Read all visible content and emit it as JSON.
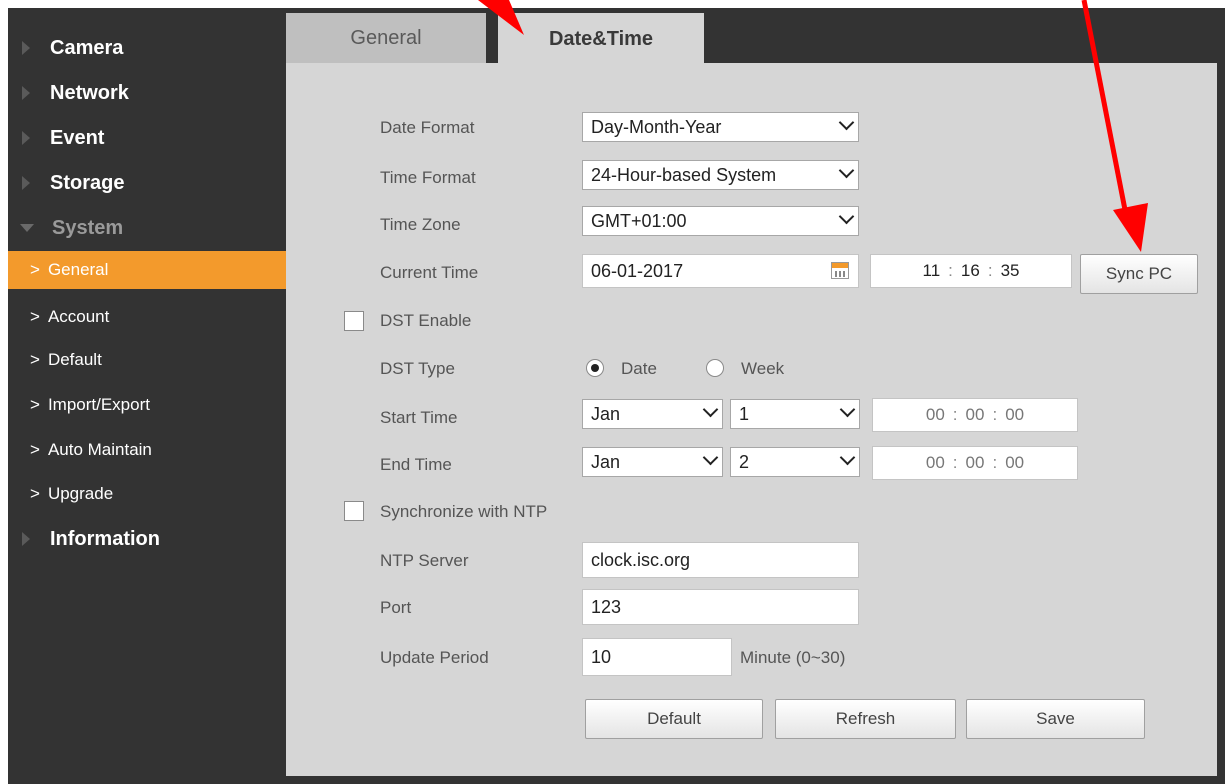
{
  "sidebar": {
    "categories": {
      "camera": "Camera",
      "network": "Network",
      "event": "Event",
      "storage": "Storage",
      "system": "System",
      "information": "Information"
    },
    "system_items": [
      "General",
      "Account",
      "Default",
      "Import/Export",
      "Auto Maintain",
      "Upgrade"
    ],
    "active_item": "General"
  },
  "tabs": [
    "General",
    "Date&Time"
  ],
  "active_tab": "Date&Time",
  "form": {
    "date_format": {
      "label": "Date Format",
      "value": "Day-Month-Year"
    },
    "time_format": {
      "label": "Time Format",
      "value": "24-Hour-based System"
    },
    "time_zone": {
      "label": "Time Zone",
      "value": "GMT+01:00"
    },
    "current_time": {
      "label": "Current Time",
      "date": "06-01-2017",
      "hh": "11",
      "mm": "16",
      "ss": "35",
      "sync_label": "Sync PC"
    },
    "dst_enable": {
      "label": "DST Enable",
      "checked": false
    },
    "dst_type": {
      "label": "DST Type",
      "options": [
        "Date",
        "Week"
      ],
      "selected": "Date"
    },
    "start_time": {
      "label": "Start Time",
      "month": "Jan",
      "day": "1",
      "hh": "00",
      "mm": "00",
      "ss": "00"
    },
    "end_time": {
      "label": "End Time",
      "month": "Jan",
      "day": "2",
      "hh": "00",
      "mm": "00",
      "ss": "00"
    },
    "ntp_sync": {
      "label": "Synchronize with NTP",
      "checked": false
    },
    "ntp_server": {
      "label": "NTP Server",
      "value": "clock.isc.org"
    },
    "port": {
      "label": "Port",
      "value": "123"
    },
    "update_period": {
      "label": "Update Period",
      "value": "10",
      "unit": "Minute (0~30)"
    }
  },
  "buttons": {
    "default": "Default",
    "refresh": "Refresh",
    "save": "Save"
  },
  "colors": {
    "accent": "#f39a2c",
    "annotation_arrow": "#ff0000"
  }
}
